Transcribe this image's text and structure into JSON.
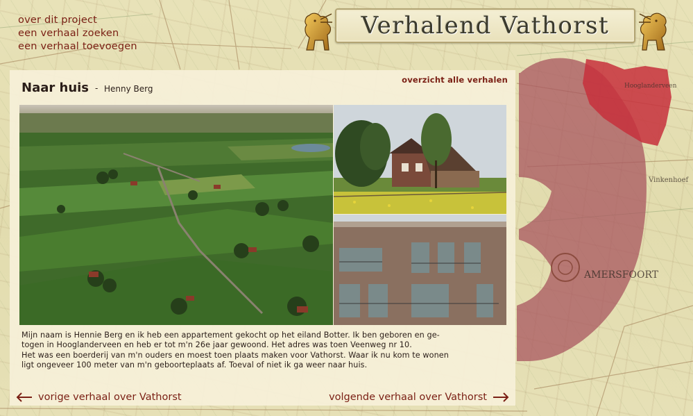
{
  "nav": {
    "items": [
      {
        "label": "over dit project"
      },
      {
        "label": "een verhaal zoeken"
      },
      {
        "label": "een verhaal toevoegen"
      }
    ]
  },
  "header": {
    "title": "Verhalend Vathorst"
  },
  "map": {
    "labels": {
      "town_large": "AMERSFOORT",
      "village_a": "Vinkenhoef",
      "village_b": "Hooglanderveen"
    },
    "colors": {
      "region": "#a8565f",
      "highlight": "#c7303c"
    }
  },
  "story": {
    "title": "Naar huis",
    "separator": "-",
    "author": "Henny Berg",
    "overview_link": "overzicht alle verhalen",
    "paragraphs": [
      "Mijn naam is Hennie Berg en ik heb een appartement gekocht op het eiland Botter. Ik ben geboren en ge-",
      "togen in Hooglanderveen en heb er tot m'n 26e  jaar gewoond. Het adres was toen Veenweg nr 10.",
      "Het was een boerderij van m'n ouders en moest toen plaats maken voor Vathorst. Waar ik nu kom te wonen",
      "ligt ongeveer 100 meter van m'n geboorteplaats af. Toeval of niet ik ga weer naar huis."
    ]
  },
  "pager": {
    "prev_label": "vorige verhaal over Vathorst",
    "next_label": "volgende verhaal over Vathorst"
  }
}
